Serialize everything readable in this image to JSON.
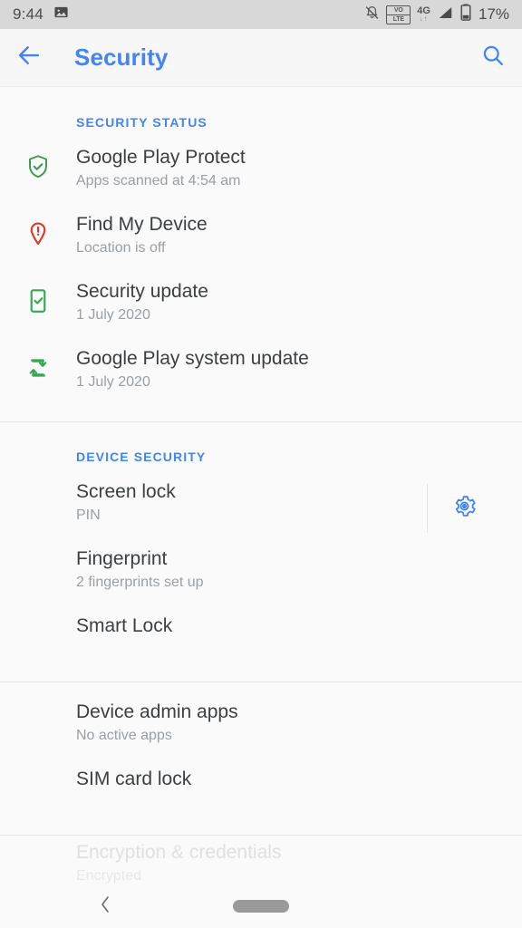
{
  "status_bar": {
    "time": "9:44",
    "photo_icon": "image-icon",
    "mute_icon": "bell-off-icon",
    "volte_top": "VO",
    "volte_bottom": "LTE",
    "network_label": "4G",
    "network_arrows": "↓↑",
    "signal_icon": "signal-bars-icon",
    "battery_icon": "battery-icon",
    "battery_percent": "17%"
  },
  "app_bar": {
    "back_icon": "arrow-left-icon",
    "title": "Security",
    "search_icon": "search-icon",
    "accent_color": "#4285f4"
  },
  "sections": [
    {
      "header": "SECURITY STATUS",
      "rows": [
        {
          "title": "Google Play Protect",
          "subtitle": "Apps scanned at 4:54 am",
          "icon": "shield-check-icon",
          "icon_color": "#3f9c52"
        },
        {
          "title": "Find My Device",
          "subtitle": "Location is off",
          "icon": "location-pin-alert-icon",
          "icon_color": "#e0392b"
        },
        {
          "title": "Security update",
          "subtitle": "1 July 2020",
          "icon": "phone-check-icon",
          "icon_color": "#34a853"
        },
        {
          "title": "Google Play system update",
          "subtitle": "1 July 2020",
          "icon": "system-update-sync-icon",
          "icon_color": "#34a853"
        }
      ]
    },
    {
      "header": "DEVICE SECURITY",
      "rows": [
        {
          "title": "Screen lock",
          "subtitle": "PIN",
          "trailing_icon": "gear-icon",
          "trailing_icon_color": "#4285f4"
        },
        {
          "title": "Fingerprint",
          "subtitle": "2 fingerprints set up"
        },
        {
          "title": "Smart Lock",
          "subtitle": ""
        }
      ]
    },
    {
      "header": "",
      "rows": [
        {
          "title": "Device admin apps",
          "subtitle": "No active apps"
        },
        {
          "title": "SIM card lock",
          "subtitle": ""
        }
      ]
    },
    {
      "header": "",
      "rows": [
        {
          "title": "Encryption & credentials",
          "subtitle": "Encrypted"
        }
      ]
    }
  ],
  "nav_bar": {
    "back_icon": "chevron-left-icon",
    "home_pill": "home-gesture-pill"
  }
}
